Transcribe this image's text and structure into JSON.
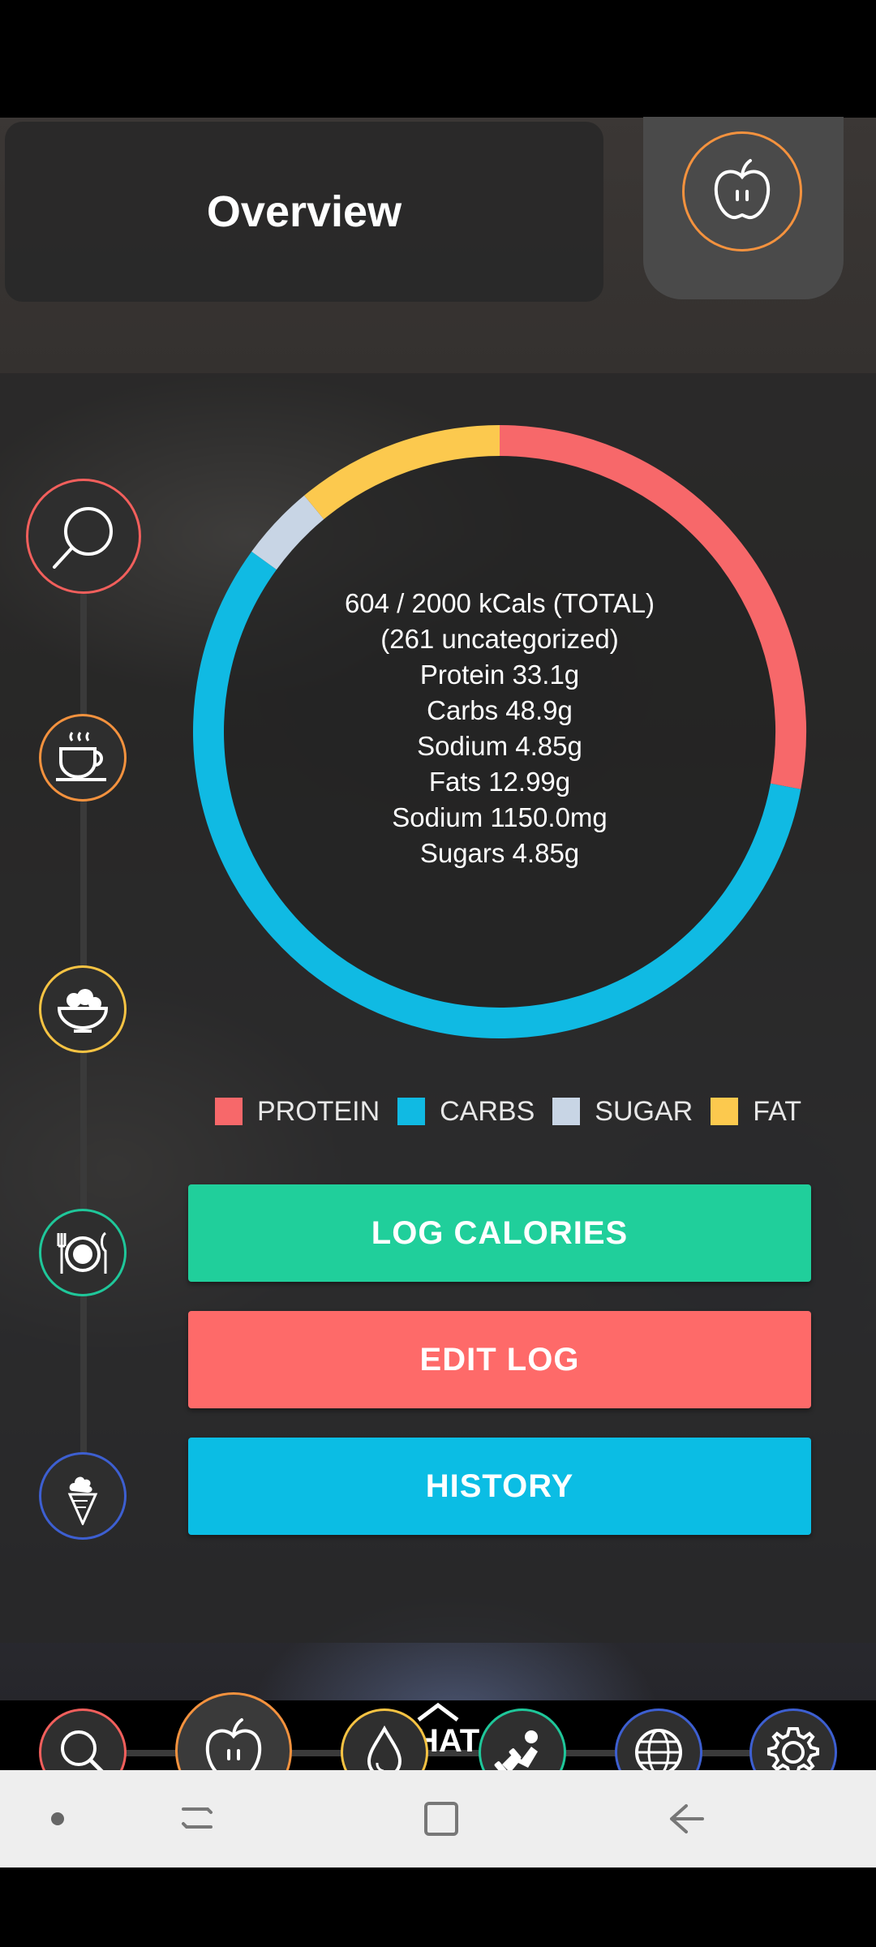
{
  "header": {
    "title": "Overview",
    "apple_icon": "apple-icon"
  },
  "rail": {
    "items": [
      {
        "icon": "search-icon",
        "color": "#f25f5c"
      },
      {
        "icon": "coffee-cup-icon",
        "color": "#f4923e"
      },
      {
        "icon": "salad-bowl-icon",
        "color": "#f6c343"
      },
      {
        "icon": "plate-cutlery-icon",
        "color": "#1fc79a"
      },
      {
        "icon": "ice-cream-icon",
        "color": "#3d5fd1"
      }
    ]
  },
  "summary": {
    "total": "604 / 2000 kCals (TOTAL)",
    "uncategorized": "(261 uncategorized)",
    "protein": "Protein 33.1g",
    "carbs": "Carbs 48.9g",
    "sodium_g": "Sodium 4.85g",
    "fats": "Fats 12.99g",
    "sodium_mg": "Sodium 1150.0mg",
    "sugars": "Sugars 4.85g"
  },
  "donut": {
    "segments": [
      {
        "name": "PROTEIN",
        "value": 28,
        "color": "#f7686a"
      },
      {
        "name": "CARBS",
        "value": 57,
        "color": "#10bae3"
      },
      {
        "name": "SUGAR",
        "value": 4,
        "color": "#c8d5e5"
      },
      {
        "name": "FAT",
        "value": 11,
        "color": "#fcc94e"
      }
    ]
  },
  "legend": [
    "PROTEIN",
    "CARBS",
    "SUGAR",
    "FAT"
  ],
  "actions": {
    "log_calories": "LOG CALORIES",
    "edit_log": "EDIT LOG",
    "history": "HISTORY"
  },
  "bottom_nav": {
    "chat_label": "HAT",
    "items": [
      {
        "icon": "search-icon",
        "color": "#f25f5c"
      },
      {
        "icon": "apple-icon",
        "color": "#f4923e"
      },
      {
        "icon": "water-drop-icon",
        "color": "#f6c343"
      },
      {
        "icon": "weightlifter-icon",
        "color": "#1fc79a"
      },
      {
        "icon": "globe-icon",
        "color": "#3d5fd1"
      },
      {
        "icon": "gear-icon",
        "color": "#3d5fd1"
      }
    ]
  },
  "system_nav": [
    "recent-dot-icon",
    "recents-icon",
    "home-square-icon",
    "back-arrow-icon"
  ]
}
